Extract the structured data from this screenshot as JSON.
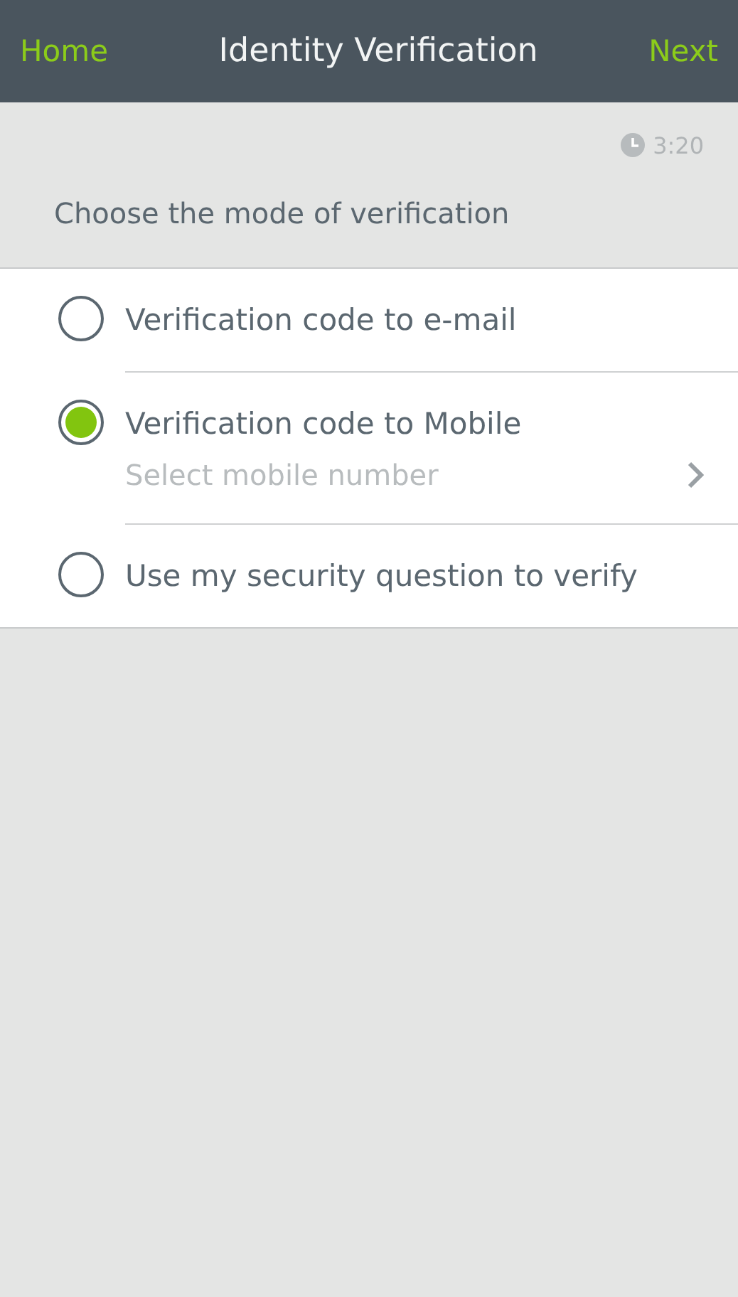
{
  "header": {
    "left_button": "Home",
    "title": "Identity Verification",
    "right_button": "Next"
  },
  "timer": "3:20",
  "prompt": "Choose the mode of verification",
  "options": [
    {
      "label": "Verification code to e-mail",
      "selected": false
    },
    {
      "label": "Verification code to Mobile",
      "selected": true,
      "sub_option": "Select mobile number"
    },
    {
      "label": "Use my security question to verify",
      "selected": false
    }
  ]
}
